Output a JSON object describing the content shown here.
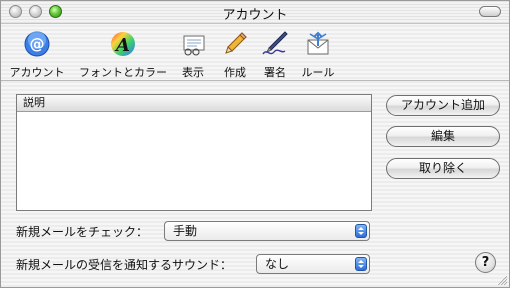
{
  "window": {
    "title": "アカウント"
  },
  "toolbar": {
    "items": [
      {
        "label": "アカウント",
        "icon": "at-sign-icon"
      },
      {
        "label": "フォントとカラー",
        "icon": "font-color-icon"
      },
      {
        "label": "表示",
        "icon": "display-icon"
      },
      {
        "label": "作成",
        "icon": "pencil-icon"
      },
      {
        "label": "署名",
        "icon": "signature-pen-icon"
      },
      {
        "label": "ルール",
        "icon": "rules-icon"
      }
    ]
  },
  "accounts_table": {
    "column_header": "説明",
    "rows": []
  },
  "buttons": {
    "add_account": "アカウント追加",
    "edit": "編集",
    "remove": "取り除く"
  },
  "check_mail": {
    "label": "新規メールをチェック：",
    "selected": "手動"
  },
  "sound": {
    "label": "新規メールの受信を通知するサウンド：",
    "selected": "なし"
  },
  "help": {
    "label": "?"
  },
  "colors": {
    "accent_blue": "#2d6ed8",
    "zoom_green": "#63c93b"
  }
}
